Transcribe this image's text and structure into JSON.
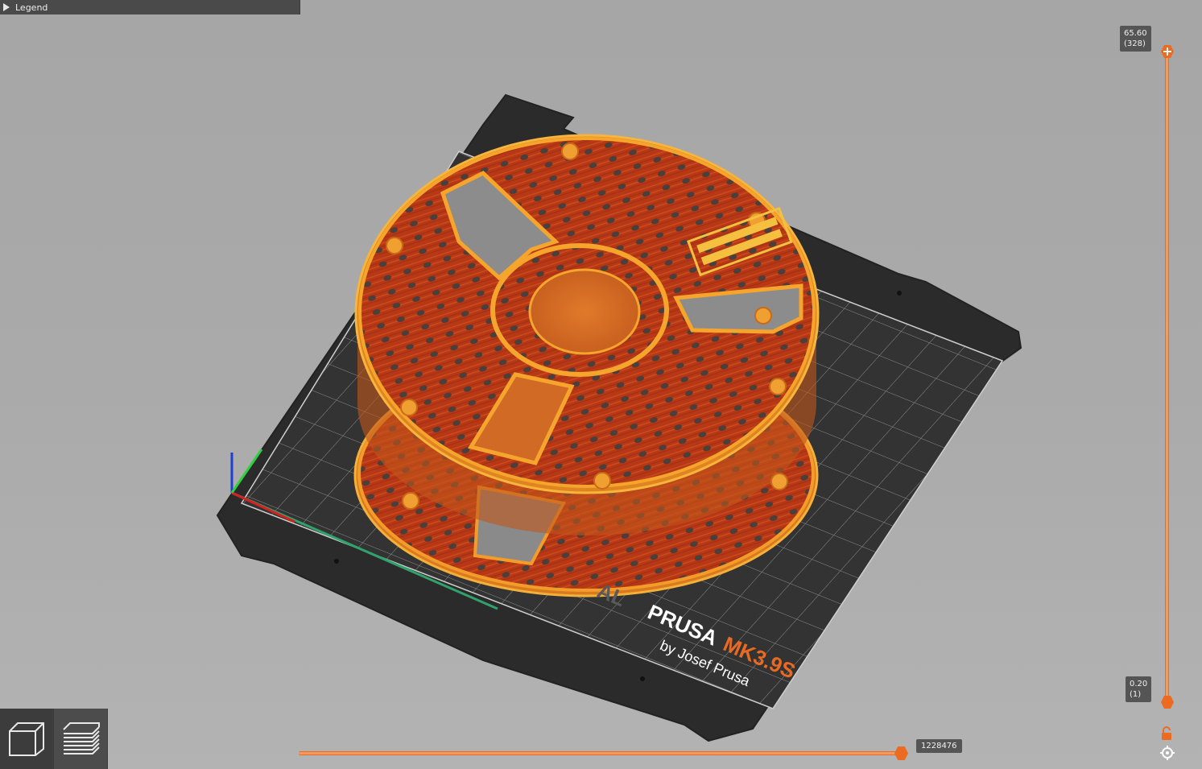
{
  "legend": {
    "label": "Legend"
  },
  "vertical_slider": {
    "top_height": "65.60",
    "top_layer": "(328)",
    "bottom_height": "0.20",
    "bottom_layer": "(1)"
  },
  "horizontal_slider": {
    "value": "1228476"
  },
  "bed": {
    "brand_faded": "AL",
    "brand": "PRUSA",
    "model": "MK3.9S",
    "byline": "by Josef Prusa"
  },
  "view_buttons": {
    "view_3d_icon": "cube-icon",
    "preview_icon": "layers-icon"
  },
  "colors": {
    "accent": "#ed6b21",
    "perimeter": "#e67e22",
    "infill": "#b83a16",
    "bed": "#2c2c2c",
    "panel": "#4a4a4a"
  }
}
